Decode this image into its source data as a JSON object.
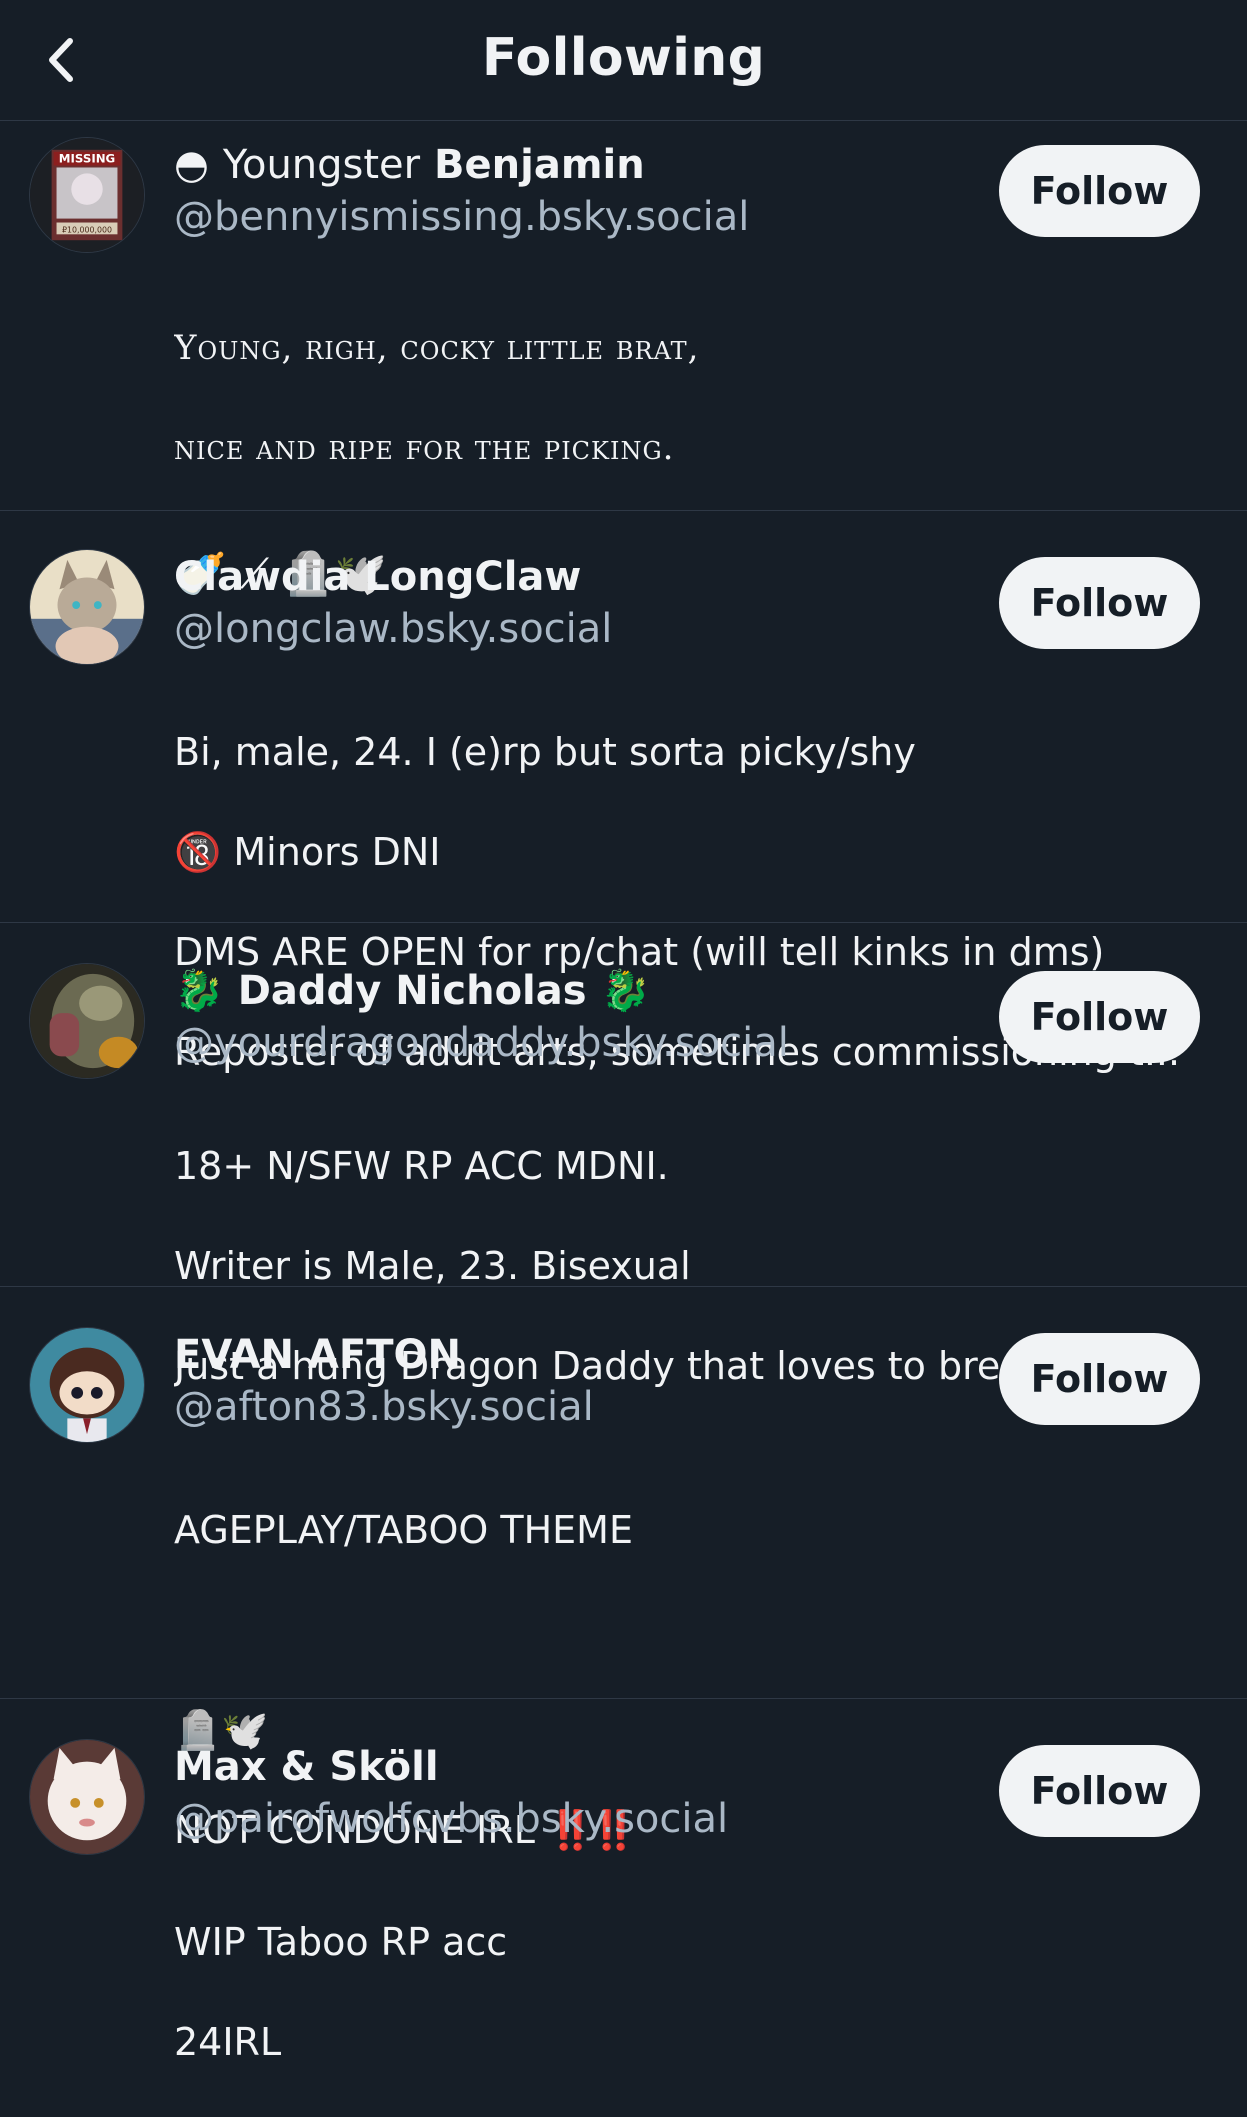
{
  "header": {
    "title": "Following",
    "back_icon": "chevron-left-icon"
  },
  "accounts": [
    {
      "name_prefix": "◓",
      "name_plain": "Youngster",
      "name_bold": "Benjamin",
      "handle": "@bennyismissing.bsky.social",
      "bio": [
        "Young, righ, cocky little brat,",
        "nice and ripe for the picking."
      ],
      "emoji_line": "🍼 ⟋ 🪦🕊️",
      "follow_label": "Follow",
      "avatar_text": "MISSING",
      "avatar_bounty": "₽10,000,000"
    },
    {
      "name": "Clawdia LongClaw",
      "handle": "@longclaw.bsky.social",
      "bio": [
        "Bi, male, 24. I (e)rp but sorta picky/shy",
        "🔞 Minors DNI",
        "DMS ARE OPEN for rp/chat (will tell kinks in dms)",
        "Reposter of adult arts, sometimes commissioning t..."
      ],
      "follow_label": "Follow"
    },
    {
      "name": "🐉 Daddy Nicholas 🐉",
      "handle": "@yourdragondaddy.bsky.social",
      "bio": [
        "18+ N/SFW RP ACC MDNI.",
        "Writer is Male, 23. Bisexual",
        "Just a hung Dragon Daddy that loves to breed brats~"
      ],
      "follow_label": "Follow"
    },
    {
      "name": "EVAN AFTON",
      "handle": "@afton83.bsky.social",
      "bio": [
        "AGEPLAY/TABOO THEME",
        "",
        "🪦🕊️",
        "NOT CONDONE IRL"
      ],
      "bio_alert": "‼️‼️",
      "follow_label": "Follow"
    },
    {
      "name": "Max & Sköll",
      "handle": "@pairofwolfcvbs.bsky.social",
      "bio": [
        "WIP Taboo RP acc",
        "24IRL"
      ],
      "follow_label": "Follow"
    }
  ],
  "colors": {
    "background": "#161e27",
    "divider": "#2e3845",
    "handle": "#aab8c6",
    "button_bg": "#f1f3f5"
  }
}
